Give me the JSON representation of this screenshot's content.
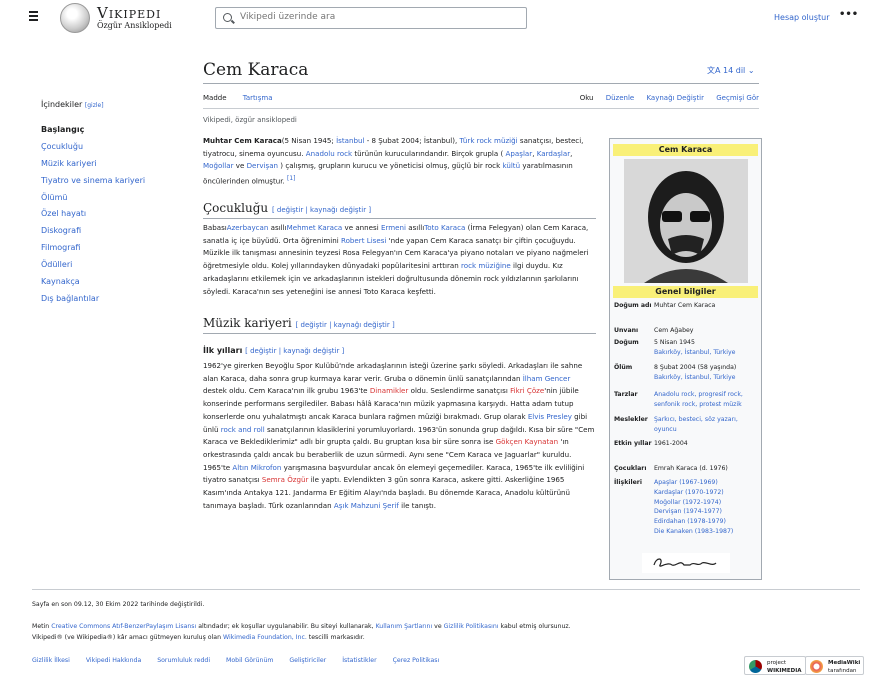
{
  "header": {
    "logo_word": "Vikipedi",
    "logo_tagline": "Özgür Ansiklopedi",
    "search_placeholder": "Vikipedi üzerinde ara",
    "account": "Hesap oluştur",
    "more": "•••"
  },
  "article": {
    "title": "Cem Karaca",
    "language_button": "14 dil",
    "tabs_left": [
      "Madde",
      "Tartışma"
    ],
    "tabs_right": [
      "Oku",
      "Düzenle",
      "Kaynağı Değiştir",
      "Geçmişi Gör"
    ],
    "from": "Vikipedi, özgür ansiklopedi"
  },
  "toc": {
    "header": "İçindekiler",
    "hide": "[gizle]",
    "items": [
      "Başlangıç",
      "Çocukluğu",
      "Müzik kariyeri",
      "Tiyatro ve sinema kariyeri",
      "Ölümü",
      "Özel hayatı",
      "Diskografi",
      "Filmografi",
      "Ödülleri",
      "Kaynakça",
      "Dış bağlantılar"
    ]
  },
  "sections": {
    "edit_links": "[ değiştir | kaynağı değiştir ]",
    "cocuklugu": "Çocukluğu",
    "muzik": "Müzik kariyeri",
    "ilk": "İlk yılları"
  },
  "intro": {
    "name_bold": "Muhtar Cem Karaca",
    "t1": "(5 Nisan 1945; ",
    "l1": "İstanbul",
    "t2": " - 8 Şubat 2004; İstanbul), ",
    "l2": "Türk rock müziği",
    "t3": " sanatçısı, besteci, tiyatrocu, sinema oyuncusu. ",
    "l3": "Anadolu rock",
    "t4": " türünün kurucularındandır. Birçok grupla ( ",
    "l4": "Apaşlar",
    "t5": ", ",
    "l5": "Kardaşlar",
    "t6": ", ",
    "l6": "Moğollar",
    "t7": " ve ",
    "l7": "Dervişan",
    "t8": " ) çalışmış, grupların kurucu ve yöneticisi olmuş, güçlü bir rock ",
    "l8": "kültü",
    "t9": " yaratılmasının öncülerinden olmuştur. ",
    "ref": "[1]"
  },
  "childhood": {
    "t1": "Babası",
    "l1": "Azerbaycan",
    "t2": " asıllı",
    "l2": "Mehmet Karaca",
    "t3": " ve annesi ",
    "l3": "Ermeni",
    "t4": " asıllı",
    "l4": "Toto Karaca",
    "t5": " (İrma Felegyan) olan Cem Karaca, sanatla iç içe büyüdü. Orta öğrenimini ",
    "l5": "Robert Lisesi",
    "t6": " 'nde yapan Cem Karaca sanatçı bir çiftin çocuğuydu. Müzikle ilk tanışması annesinin teyzesi Rosa Felegyan'ın Cem Karaca'ya piyano notaları ve piyano nağmeleri öğretmesiyle oldu. Kolej yıllarındayken dünyadaki popülaritesini arttıran ",
    "l6": "rock müziğine",
    "t7": " ilgi duydu. Kız arkadaşlarını etkilemek için ve arkadaşlarının istekleri doğrultusunda dönemin rock yıldızlarının şarkılarını söyledi. Karaca'nın ses yeteneğini ise annesi Toto Karaca keşfetti."
  },
  "early": {
    "t1": "1962'ye girerken Beyoğlu Spor Kulübü'nde arkadaşlarının isteği üzerine şarkı söyledi. Arkadaşları ile sahne alan Karaca, daha sonra grup kurmaya karar verir. Gruba o dönemin ünlü sanatçılarından ",
    "l1": "İlham Gencer",
    "t2": " destek oldu. Cem Karaca'nın ilk grubu 1963'te ",
    "l2": "Dinamikler",
    "t3": " oldu. Seslendirme sanatçısı ",
    "l3": "Fikri Çöze",
    "t4": "'nin jübile konserinde performans sergilediler. Babası hâlâ Karaca'nın müzik yapmasına karşıydı. Hatta adam tutup konserlerde onu yuhalatmıştı ancak Karaca bunlara rağmen müziği bırakmadı. Grup olarak ",
    "l4": "Elvis Presley",
    "t5": " gibi ünlü ",
    "l5": "rock and roll",
    "t6": " sanatçılarının klasiklerini yorumluyorlardı. 1963'ün sonunda grup dağıldı. Kısa bir süre \"Cem Karaca ve Beklediklerimiz\" adlı bir grupta çaldı. Bu gruptan kısa bir süre sonra ise ",
    "l6": "Gökçen Kaynatan",
    "t7": " 'ın orkestrasında çaldı ancak bu beraberlik de uzun sürmedi. Aynı sene \"Cem Karaca ve Jaguarlar\" kuruldu. 1965'te ",
    "l7": "Altın Mikrofon",
    "t8": " yarışmasına başvurdular ancak ön elemeyi geçemediler. Karaca, 1965'te ilk evliliğini tiyatro sanatçısı ",
    "l8": "Semra Özgür",
    "t9": " ile yaptı. Evlendikten 3 gün sonra Karaca, askere gitti. Askerliğine 1965 Kasım'ında Antakya 121. Jandarma Er Eğitim Alayı'nda başladı. Bu dönemde Karaca, Anadolu kültürünü tanımaya başladı. Türk ozanlarından ",
    "l9": "Aşık Mahzuni Şerif",
    "t10": " ile tanıştı."
  },
  "infobox": {
    "name": "Cem Karaca",
    "general": "Genel bilgiler",
    "rows": [
      {
        "k": "Doğum adı",
        "v": [
          "Muhtar Cem Karaca"
        ]
      },
      {
        "k": "Unvanı",
        "v": [
          "Cem Ağabey"
        ]
      },
      {
        "k": "Doğum",
        "v": [
          "5 Nisan 1945",
          "Bakırköy, İstanbul, Türkiye"
        ]
      },
      {
        "k": "Ölüm",
        "v": [
          "8 Şubat 2004 (58 yaşında)",
          "Bakırköy, İstanbul, Türkiye"
        ]
      },
      {
        "k": "Tarzlar",
        "v": [
          "Anadolu rock, progresif rock, senfonik rock, protest müzik"
        ]
      },
      {
        "k": "Meslekler",
        "v": [
          "Şarkıcı, besteci, söz yazarı, oyuncu"
        ]
      },
      {
        "k": "Etkin yıllar",
        "v": [
          "1961-2004"
        ]
      },
      {
        "k": "Çocukları",
        "v": [
          "Emrah Karaca (d. 1976)"
        ]
      },
      {
        "k": "İlişkileri",
        "v": [
          "Apaşlar (1967-1969)",
          "Kardaşlar (1970-1972)",
          "Moğollar (1972-1974)",
          "Dervişan (1974-1977)",
          "Edirdahan (1978-1979)",
          "Die Kanaken (1983-1987)"
        ]
      }
    ]
  },
  "footer": {
    "modified": "Sayfa en son 09.12, 30 Ekim 2022 tarihinde değiştirildi.",
    "license_1": "Metin ",
    "license_link": "Creative Commons Atıf-BenzerPaylaşım Lisansı",
    "license_2": " altındadır; ek koşullar uygulanabilir. Bu siteyi kullanarak, ",
    "terms": "Kullanım Şartlarını",
    "license_3": " ve ",
    "privacy": "Gizlilik Politikasını",
    "license_4": " kabul etmiş olursunuz.",
    "trademark_1": "Vikipedi® (ve Wikipedia®) kâr amacı gütmeyen kuruluş olan ",
    "trademark_link": "Wikimedia Foundation, Inc.",
    "trademark_2": " tescilli markasıdır.",
    "links": [
      "Gizlilik İlkesi",
      "Vikipedi Hakkında",
      "Sorumluluk reddi",
      "Mobil Görünüm",
      "Geliştiriciler",
      "İstatistikler",
      "Çerez Politikası"
    ],
    "badge1_a": "WIKIMEDIA",
    "badge1_b": "project",
    "badge2_a": "MediaWiki",
    "badge2_b": "tarafından"
  },
  "colors": {
    "link": "#3366cc",
    "redlink": "#d73333",
    "infobox_header": "#f9f078"
  }
}
